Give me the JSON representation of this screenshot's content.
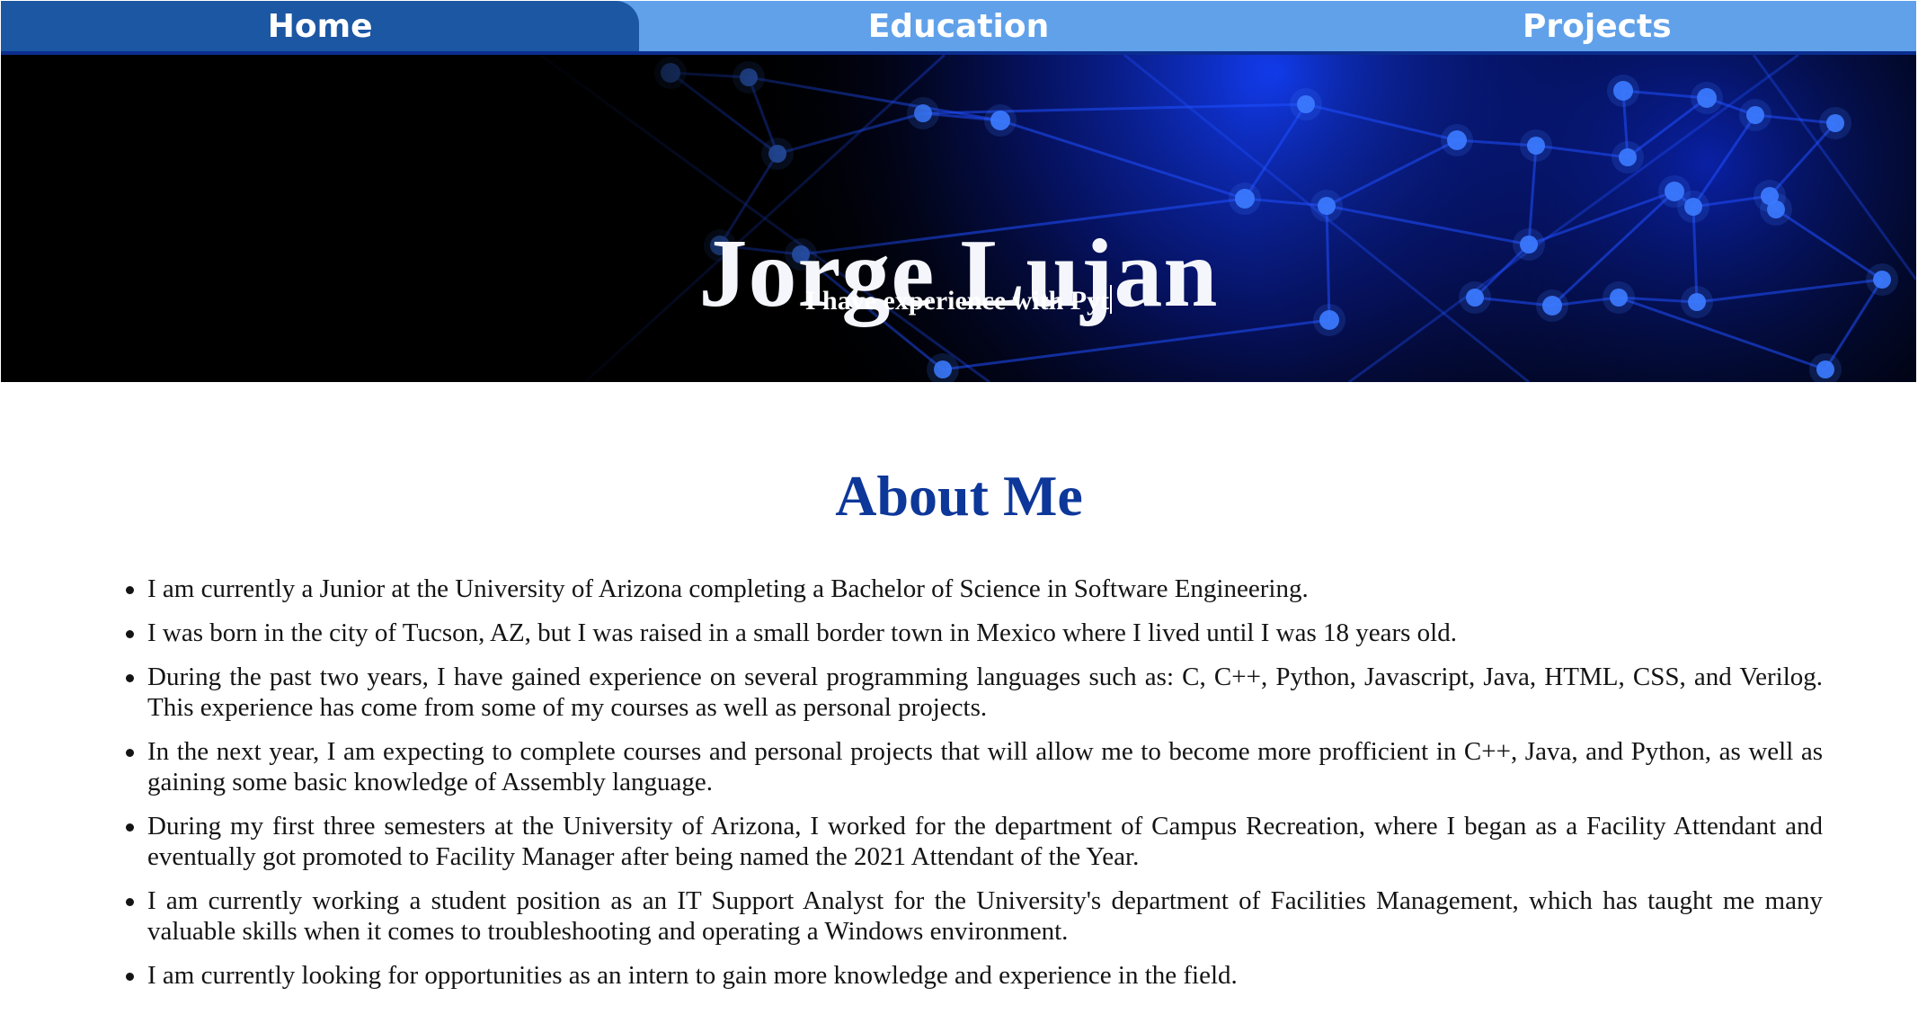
{
  "nav": {
    "tabs": [
      {
        "label": "Home",
        "active": true
      },
      {
        "label": "Education",
        "active": false
      },
      {
        "label": "Projects",
        "active": false
      }
    ]
  },
  "hero": {
    "name": "Jorge Lujan",
    "typed_text": "I have experience with Pyt"
  },
  "about": {
    "title": "About Me",
    "items": [
      "I am currently a Junior at the University of Arizona completing a Bachelor of Science in Software Engineering.",
      "I was born in the city of Tucson, AZ, but I was raised in a small border town in Mexico where I lived until I was 18 years old.",
      "During the past two years, I have gained experience on several programming languages such as: C, C++, Python, Javascript, Java, HTML, CSS, and Verilog. This experience has come from some of my courses as well as personal projects.",
      "In the next year, I am expecting to complete courses and personal projects that will allow me to become more profficient in C++, Java, and Python, as well as gaining some basic knowledge of Assembly language.",
      "During my first three semesters at the University of Arizona, I worked for the department of Campus Recreation, where I began as a Facility Attendant and eventually got promoted to Facility Manager after being named the 2021 Attendant of the Year.",
      "I am currently working a student position as an IT Support Analyst for the University's department of Facilities Management, which has taught me many valuable skills when it comes to troubleshooting and operating a Windows environment.",
      "I am currently looking for opportunities as an intern to gain more knowledge and experience in the field."
    ]
  },
  "colors": {
    "nav_bg": "#60a1ea",
    "nav_active": "#1b57a3",
    "nav_border": "#0b2d8f",
    "heading": "#0d3799",
    "network_line": "#1f4fff",
    "network_node": "#3b7bff"
  }
}
